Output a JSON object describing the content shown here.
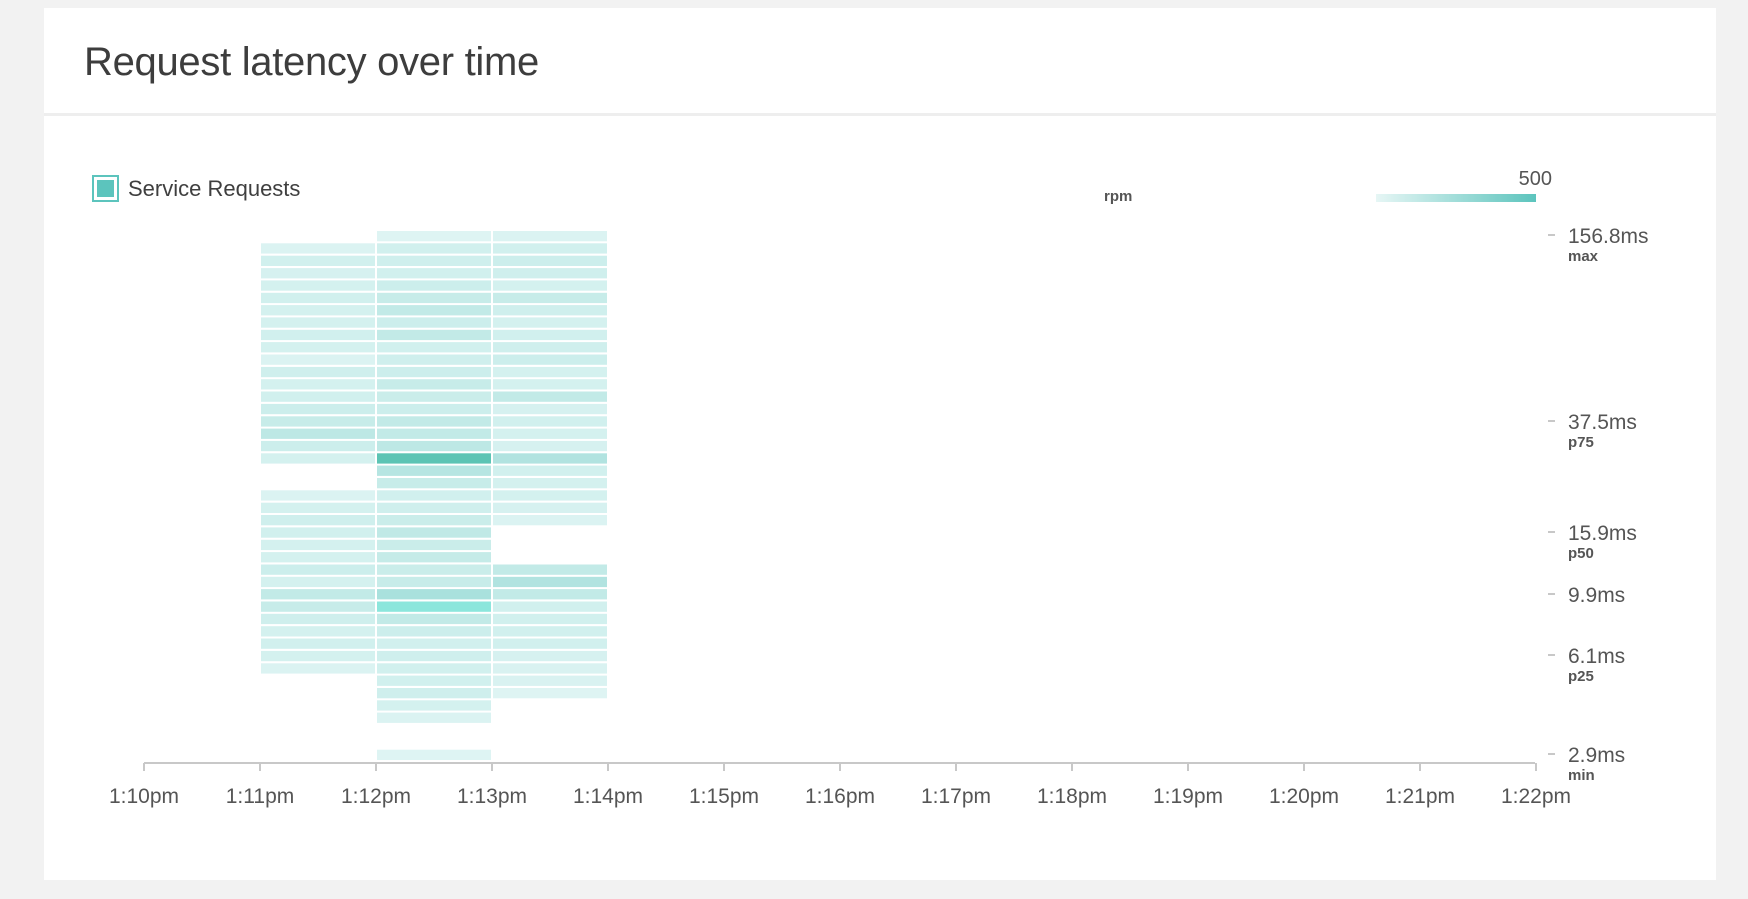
{
  "card": {
    "title": "Request latency over time"
  },
  "legend": {
    "series_label": "Service Requests",
    "unit_label": "rpm",
    "max_label": "500",
    "color": "#5cc4bd"
  },
  "chart_data": {
    "type": "heatmap",
    "title": "Request latency over time",
    "x_ticks": [
      "1:10pm",
      "1:11pm",
      "1:12pm",
      "1:13pm",
      "1:14pm",
      "1:15pm",
      "1:16pm",
      "1:17pm",
      "1:18pm",
      "1:19pm",
      "1:20pm",
      "1:21pm",
      "1:22pm"
    ],
    "y_labels": [
      {
        "value": "156.8ms",
        "tag": "max",
        "ms": 156.8
      },
      {
        "value": "37.5ms",
        "tag": "p75",
        "ms": 37.5
      },
      {
        "value": "15.9ms",
        "tag": "p50",
        "ms": 15.9
      },
      {
        "value": "9.9ms",
        "tag": "",
        "ms": 9.9
      },
      {
        "value": "6.1ms",
        "tag": "p25",
        "ms": 6.1
      },
      {
        "value": "2.9ms",
        "tag": "min",
        "ms": 2.9
      }
    ],
    "color_scale": {
      "min": 0,
      "max": 500,
      "unit": "rpm"
    },
    "bins": 43,
    "columns": [
      {
        "x": "1:11pm",
        "start_bin": 1,
        "values": [
          0.1,
          0.18,
          0.14,
          0.16,
          0.18,
          0.16,
          0.16,
          0.18,
          0.16,
          0.1,
          0.2,
          0.16,
          0.18,
          0.22,
          0.26,
          0.34,
          0.22,
          0.16,
          0.0,
          0.0,
          0.1,
          0.16,
          0.2,
          0.18,
          0.16,
          0.16,
          0.22,
          0.16,
          0.3,
          0.26,
          0.2,
          0.16,
          0.18,
          0.16,
          0.1,
          0.0,
          0.0,
          0.0,
          0.0,
          0.0
        ]
      },
      {
        "x": "1:12pm",
        "start_bin": 0,
        "values": [
          0.08,
          0.18,
          0.2,
          0.18,
          0.22,
          0.26,
          0.3,
          0.22,
          0.3,
          0.18,
          0.2,
          0.22,
          0.26,
          0.24,
          0.22,
          0.3,
          0.3,
          0.34,
          1.0,
          0.4,
          0.26,
          0.18,
          0.2,
          0.24,
          0.32,
          0.24,
          0.28,
          0.24,
          0.26,
          0.5,
          0.66,
          0.3,
          0.22,
          0.18,
          0.2,
          0.18,
          0.18,
          0.2,
          0.16,
          0.1,
          0.0,
          0.0,
          0.08,
          0.08
        ]
      },
      {
        "x": "1:13pm",
        "start_bin": 0,
        "values": [
          0.1,
          0.18,
          0.22,
          0.2,
          0.16,
          0.26,
          0.2,
          0.16,
          0.18,
          0.2,
          0.22,
          0.16,
          0.16,
          0.3,
          0.14,
          0.18,
          0.16,
          0.14,
          0.44,
          0.18,
          0.16,
          0.16,
          0.14,
          0.1,
          0.0,
          0.0,
          0.0,
          0.3,
          0.44,
          0.3,
          0.18,
          0.18,
          0.18,
          0.18,
          0.14,
          0.12,
          0.12,
          0.08,
          0.0,
          0.0,
          0.0,
          0.0,
          0.0
        ]
      }
    ]
  }
}
